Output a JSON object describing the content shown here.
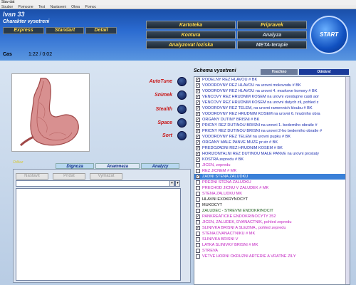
{
  "window": {
    "title": "Stav dat"
  },
  "menu": [
    "Soubor",
    "Pomocne",
    "Test",
    "Nastaveni",
    "Okna",
    "Pomoc"
  ],
  "header": {
    "user_name": "Ivan  33",
    "character_label": "Charakter vysetreni",
    "mode_buttons": [
      "Express",
      "Standart",
      "Detail"
    ],
    "left_buttons": [
      "Kartoteka",
      "Kontura",
      "Analyzovat loziska"
    ],
    "right_buttons": [
      "Pripravek",
      "Analyza",
      "META-terapie"
    ],
    "start_label": "START",
    "time_label": "Cas",
    "time_value": "1:22 / 0:02"
  },
  "options": {
    "items": [
      "AutoTune",
      "Snimek",
      "Stealth",
      "Space",
      "Sort"
    ]
  },
  "schema": {
    "title": "Schema vysetreni",
    "tab_all": "Vsechno",
    "tab_remove": "Odebrat",
    "items": [
      {
        "text": "PODELNY REZ HLAVOU # BK",
        "color": "blue",
        "checked": true
      },
      {
        "text": "VODOROVNY REZ HLAVOU na urovni mokovodu # BK",
        "color": "blue",
        "checked": true
      },
      {
        "text": "VODOROVNY REZ HLAVOU na urovni 4. mozkove komory # BK",
        "color": "blue",
        "checked": true
      },
      {
        "text": "VENCOVY REZ HRUDNIM KOSEM  na urovni vzestupne casti aor",
        "color": "blue",
        "checked": true
      },
      {
        "text": "VENCOVY REZ HRUDNIM KOSEM  na urovni dutych zil, pohled z",
        "color": "blue",
        "checked": true
      },
      {
        "text": "VODOROVNY REZ TELEM, na urovni ramennich kloubu # BK",
        "color": "blue",
        "checked": true
      },
      {
        "text": "VODOROVNY REZ HRUDNIM KOSEM na urovni 6. hrudniho obra",
        "color": "blue",
        "checked": true
      },
      {
        "text": "ORGANY DUTINY BRISNI  # BK",
        "color": "blue",
        "checked": true
      },
      {
        "text": "PRICNY REZ DUTINOU BRISNI na urovni 1. bederniho obratle  #",
        "color": "blue",
        "checked": true
      },
      {
        "text": "PRICNY REZ DUTINOU BRISNI na urovni 2-ho bederniho obratle #",
        "color": "blue",
        "checked": true
      },
      {
        "text": "VODOROVNY REZ TELEM na urovni pupku # BK",
        "color": "blue",
        "checked": true
      },
      {
        "text": "ORGANY MALE PANVE MUZE pr.str  # BK",
        "color": "blue",
        "checked": true
      },
      {
        "text": "PREDOZADNI REZ HRUDNIM KOSEM # BK",
        "color": "blue",
        "checked": true
      },
      {
        "text": "HORIZONTALNI REZ DUTINOU MALE PANVE na urovni prostaty",
        "color": "blue",
        "checked": true
      },
      {
        "text": "KOSTRA zepredu # BK",
        "color": "blue",
        "checked": true
      },
      {
        "text": "JICEN,  zepredu",
        "color": "pink",
        "checked": false
      },
      {
        "text": "REZ JICNEM # MK",
        "color": "pink",
        "checked": false
      },
      {
        "text": "ZADNI STENA ZALUDKU",
        "color": "pink",
        "checked": true,
        "selected": true
      },
      {
        "text": "PREDNI STENA ZALUDKU",
        "color": "pink",
        "checked": false
      },
      {
        "text": "PRECHOD JICNU V ZALUDEK # MK",
        "color": "pink",
        "checked": false
      },
      {
        "text": "STENA ZALUDKU MK",
        "color": "pink",
        "checked": false
      },
      {
        "text": "HLAVNI  EXOKRYNOCYT",
        "color": "black",
        "checked": false
      },
      {
        "text": "MUKOCYT",
        "color": "black",
        "checked": false
      },
      {
        "text": "ZALUDEC  - STREVNI  ENDOKRINOCIT",
        "color": "green",
        "checked": false
      },
      {
        "text": "PANKREATICKE ENDOKRINOCYTY 352",
        "color": "pink",
        "checked": true
      },
      {
        "text": "JICEN, ZALUDEK, DVANACTNIK,  pohled zepredu",
        "color": "pink",
        "checked": false
      },
      {
        "text": "SLINIVKA BRISNI A SLEZINA  , pohled zepredu",
        "color": "pink",
        "checked": true
      },
      {
        "text": "STENA DVANACTNIKU # MK",
        "color": "pink",
        "checked": false
      },
      {
        "text": "SLINIVKA BRISNI   V",
        "color": "pink",
        "checked": false
      },
      {
        "text": "LATKA SLINIVKY BRISNI # MK",
        "color": "pink",
        "checked": false
      },
      {
        "text": "STREVA",
        "color": "pink",
        "checked": false
      },
      {
        "text": "VETVE HORNI OKRUZNI ARTERIE A VRATNE ZILY",
        "color": "pink",
        "checked": false
      }
    ]
  },
  "lower": {
    "label": "Odkaz",
    "tabs": [
      "Dignoza",
      "Anamneza",
      "Analyzy"
    ],
    "buttons": [
      "Nastavit",
      "Pridat",
      "Vymazat"
    ]
  },
  "colors": {
    "header_blue": "#2a6ad0",
    "accent_yellow": "#ffd84a",
    "option_red": "#c81818",
    "selection_blue": "#3a80d8"
  }
}
